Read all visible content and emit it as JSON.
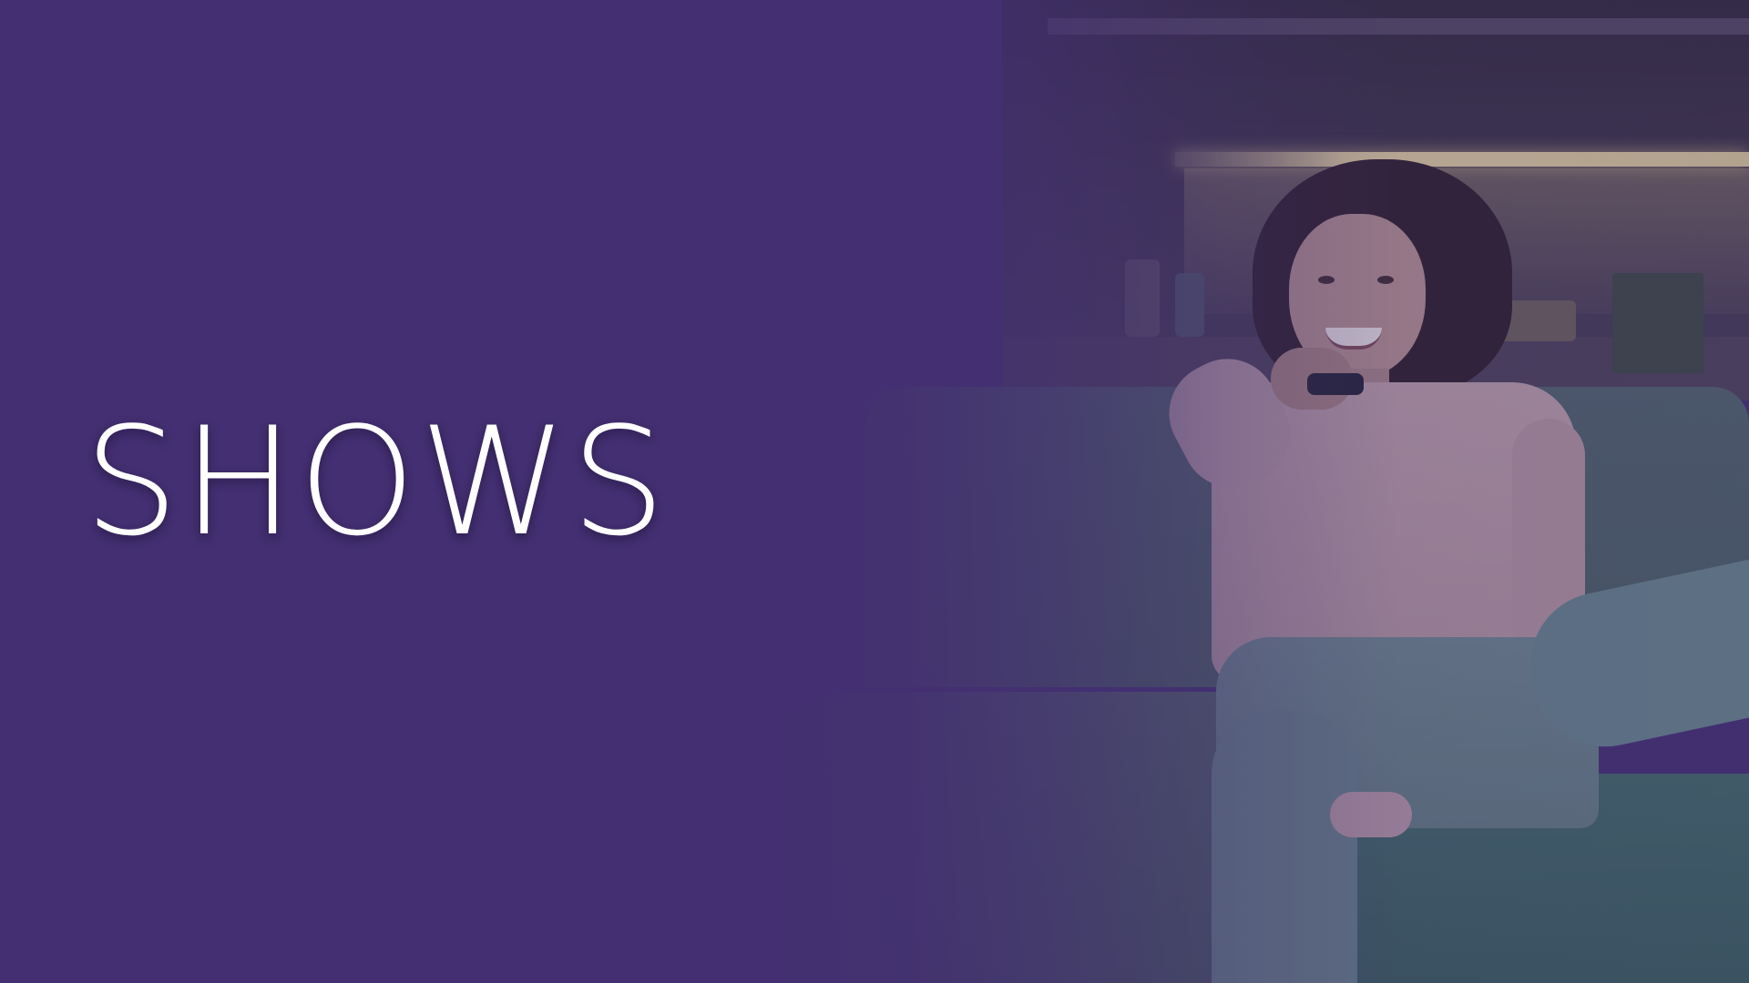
{
  "screen": {
    "title": "SHOWS"
  },
  "colors": {
    "background_purple": "#432f71",
    "title_text": "#ffffff"
  },
  "background_image": {
    "subject": "woman-on-couch-holding-remote"
  }
}
